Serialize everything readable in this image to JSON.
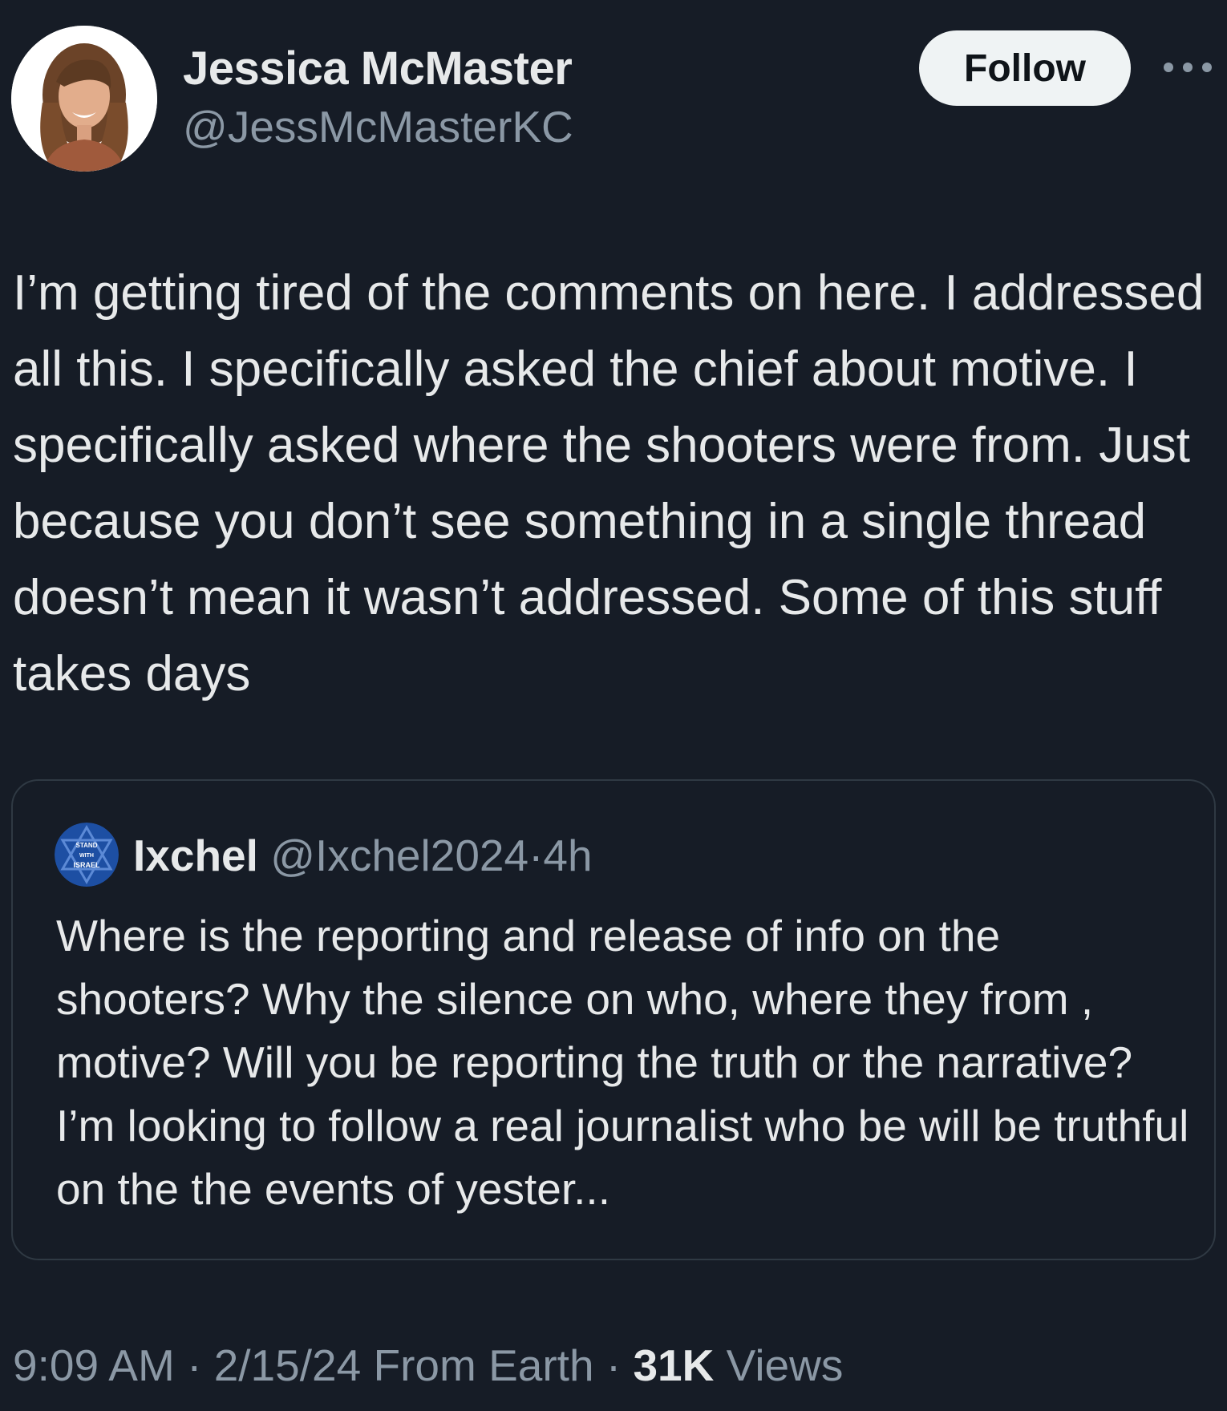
{
  "author": {
    "display_name": "Jessica McMaster",
    "handle": "@JessMcMasterKC",
    "avatar_icon": "profile-photo"
  },
  "actions": {
    "follow_label": "Follow",
    "more_icon": "ellipsis-icon"
  },
  "tweet": {
    "text": "I’m getting tired of the comments on here. I addressed all this. I specifically asked the chief about motive. I specifically asked where the shooters were from. Just because you don’t see something in a single thread doesn’t mean it wasn’t addressed. Some of this stuff takes days"
  },
  "quoted_tweet": {
    "display_name": "Ixchel",
    "handle": "@Ixchel2024",
    "separator": "·",
    "time": "4h",
    "avatar_text": [
      "STAND",
      "WITH",
      "ISRAEL"
    ],
    "text": "Where is the reporting and release of info on the shooters?  Why the silence on who, where they from , motive?  Will you be reporting the truth or the narrative? I’m looking to follow a real journalist who be will be truthful on the the events of yester..."
  },
  "meta": {
    "time": "9:09 AM",
    "sep1": "·",
    "date": "2/15/24",
    "source": "From Earth",
    "sep2": "·",
    "views_count": "31K",
    "views_label": "Views"
  },
  "colors": {
    "background": "#161c26",
    "text": "#e7e9ea",
    "secondary": "#8b98a5",
    "border": "#2f3943",
    "follow_bg": "#eff3f4"
  }
}
